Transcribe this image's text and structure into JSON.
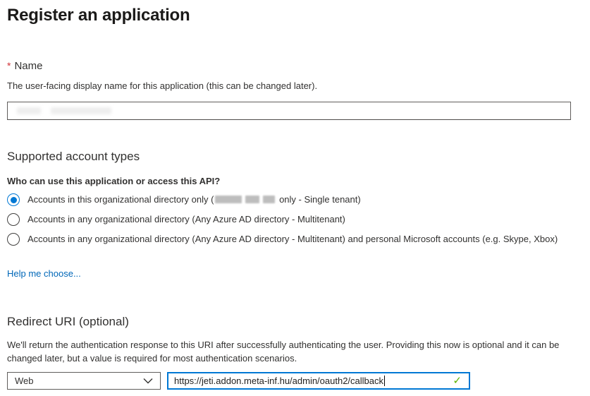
{
  "page": {
    "title": "Register an application"
  },
  "name_section": {
    "required_marker": "*",
    "label": "Name",
    "description": "The user-facing display name for this application (this can be changed later).",
    "input_value": "",
    "input_redacted": true
  },
  "account_types": {
    "heading": "Supported account types",
    "question": "Who can use this application or access this API?",
    "options": [
      {
        "label_prefix": "Accounts in this organizational directory only (",
        "redacted_tenant": true,
        "label_suffix": " only - Single tenant)",
        "selected": true
      },
      {
        "label": "Accounts in any organizational directory (Any Azure AD directory - Multitenant)",
        "selected": false
      },
      {
        "label": "Accounts in any organizational directory (Any Azure AD directory - Multitenant) and personal Microsoft accounts (e.g. Skype, Xbox)",
        "selected": false
      }
    ],
    "help_link": "Help me choose..."
  },
  "redirect_uri": {
    "heading": "Redirect URI (optional)",
    "description": "We'll return the authentication response to this URI after successfully authenticating the user. Providing this now is optional and it can be changed later, but a value is required for most authentication scenarios.",
    "platform_selected": "Web",
    "uri_value": "https://jeti.addon.meta-inf.hu/admin/oauth2/callback",
    "validation_state": "valid",
    "check_glyph": "✓"
  },
  "colors": {
    "accent_blue": "#0078d4",
    "link_blue": "#0067b8",
    "valid_green": "#5db300",
    "required_red": "#d13438",
    "text": "#323130",
    "border_gray": "#605e5c"
  }
}
